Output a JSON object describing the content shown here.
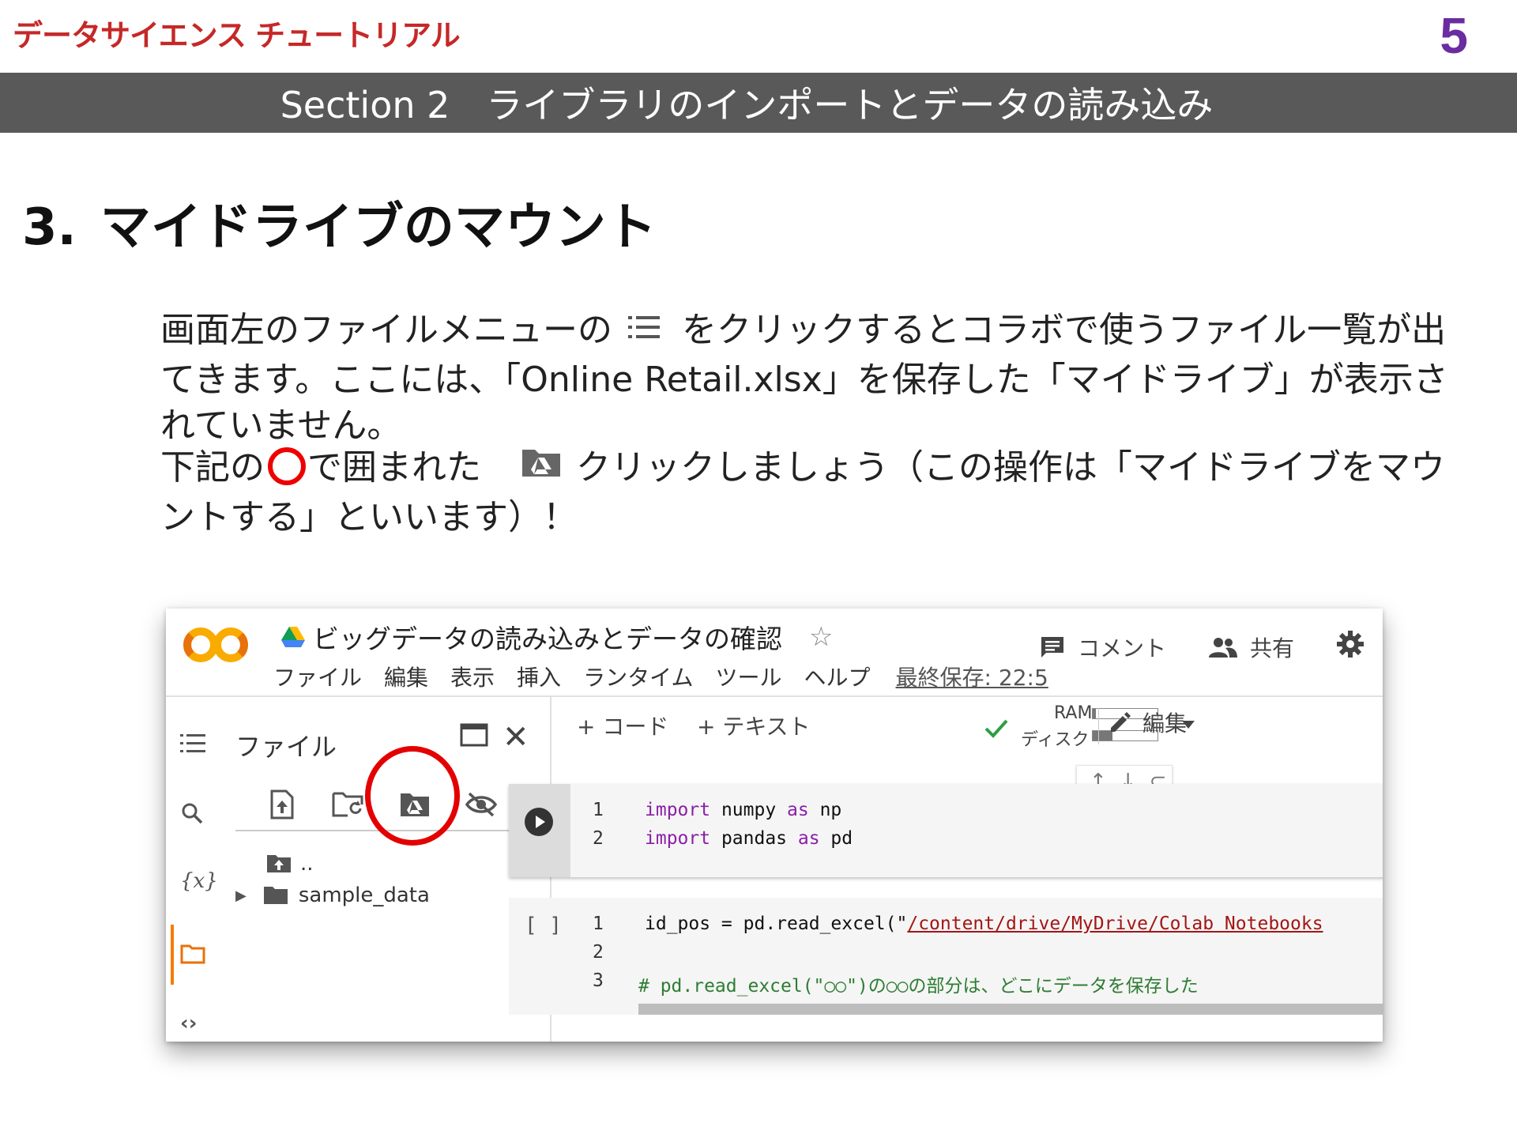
{
  "slide": {
    "brand": "データサイエンス チュートリアル",
    "page_number": "5",
    "section": "Section 2　ライブラリのインポートとデータの読み込み",
    "heading_number": "3.",
    "heading_text": "マイドライブのマウント",
    "para1_a": "画面左のファイルメニューの",
    "para1_b": "をクリックするとコラボで使うファイル一覧が出てきます。ここには、「Online Retail.xlsx」を保存した「マイドライブ」が表示されていません。",
    "para2_a": "下記の",
    "para2_b": "で囲まれた",
    "para2_c": "クリックしましょう（この操作は「マイドライブをマウントする」といいます）！"
  },
  "colab": {
    "notebook_title": "ビッグデータの読み込みとデータの確認",
    "menus": [
      "ファイル",
      "編集",
      "表示",
      "挿入",
      "ランタイム",
      "ツール",
      "ヘルプ"
    ],
    "last_saved": "最終保存: 22:5",
    "comment_label": "コメント",
    "share_label": "共有",
    "files_title": "ファイル",
    "parent_dir": "..",
    "folder_name": "sample_data",
    "add_code": "+ コード",
    "add_text": "+ テキスト",
    "ram_label": "RAM",
    "disk_label": "ディスク",
    "ram_usage": 0.05,
    "disk_usage": 0.3,
    "edit_label": "編集",
    "bracket": "[ ]",
    "cell1_lines": [
      {
        "n": "1",
        "kw1": "import",
        "mod": " numpy ",
        "kw2": "as",
        "alias": " np"
      },
      {
        "n": "2",
        "kw1": "import",
        "mod": " pandas ",
        "kw2": "as",
        "alias": " pd"
      }
    ],
    "cell2_line1_prefix": "id_pos = pd.read_excel(\"",
    "cell2_line1_path": "/content/drive/MyDrive/Colab",
    "cell2_line1_suffix": " Notebooks",
    "cell2_line3": "# pd.read_excel(\"○○\")の○○の部分は、どこにデータを保存した",
    "line_nums2": [
      "1",
      "2",
      "3"
    ]
  }
}
